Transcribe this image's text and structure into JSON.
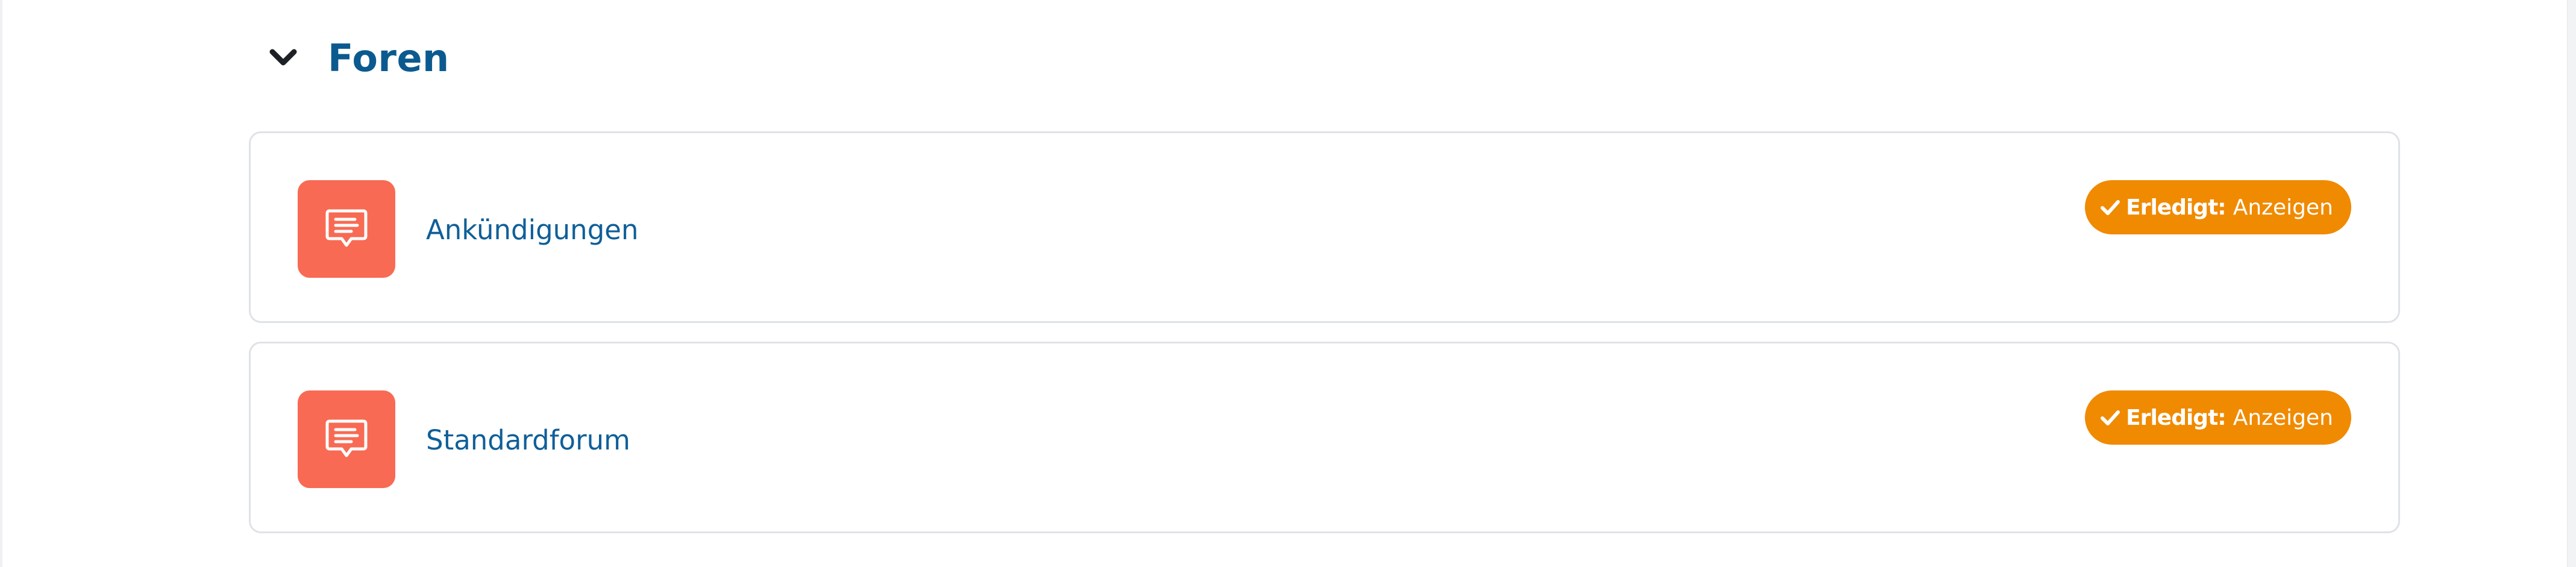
{
  "section": {
    "title": "Foren",
    "toggle_icon": "chevron-down-icon"
  },
  "activities": [
    {
      "name": "Ankündigungen",
      "icon": "forum-icon",
      "completion": {
        "status": "Erledigt:",
        "action": "Anzeigen",
        "icon": "check-icon"
      }
    },
    {
      "name": "Standardforum",
      "icon": "forum-icon",
      "completion": {
        "status": "Erledigt:",
        "action": "Anzeigen",
        "icon": "check-icon"
      }
    }
  ],
  "colors": {
    "title": "#0b5a8f",
    "link": "#0f5f98",
    "forum_icon_bg": "#f86a53",
    "badge_bg": "#f08a00",
    "card_border": "#dfe2e6"
  }
}
